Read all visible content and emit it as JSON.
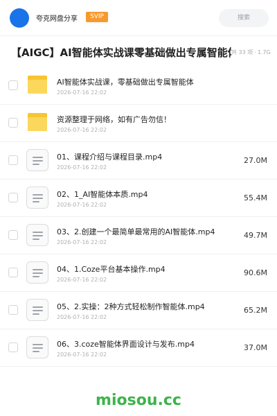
{
  "header": {
    "share_name": "夸克网盘分享",
    "badge": "SVIP",
    "search_placeholder": "搜索"
  },
  "folder": {
    "title": "【AIGC】AI智能体实战课零基础做出专属智能体",
    "item_count": "共 33 项",
    "total_size": "1.7G"
  },
  "items": [
    {
      "type": "folder",
      "name": "AI智能体实战课，零基础做出专属智能体",
      "date": "2026-07-16 22:02",
      "size": ""
    },
    {
      "type": "folder",
      "name": "资源整理于网络，如有广告勿信！",
      "date": "2026-07-16 22:02",
      "size": ""
    },
    {
      "type": "file",
      "name": "01、课程介绍与课程目录.mp4",
      "date": "2026-07-16 22:02",
      "size": "27.0M"
    },
    {
      "type": "file",
      "name": "02、1_AI智能体本质.mp4",
      "date": "2026-07-16 22:02",
      "size": "55.4M"
    },
    {
      "type": "file",
      "name": "03、2.创建一个最简单最常用的AI智能体.mp4",
      "date": "2026-07-16 22:02",
      "size": "49.7M"
    },
    {
      "type": "file",
      "name": "04、1.Coze平台基本操作.mp4",
      "date": "2026-07-16 22:02",
      "size": "90.6M"
    },
    {
      "type": "file",
      "name": "05、2.实操：2种方式轻松制作智能体.mp4",
      "date": "2026-07-16 22:02",
      "size": "65.2M"
    },
    {
      "type": "file",
      "name": "06、3.coze智能体界面设计与发布.mp4",
      "date": "2026-07-16 22:02",
      "size": "37.0M"
    }
  ],
  "watermark": "miosou.cc",
  "colors": {
    "accent": "#1a73e8",
    "svip": "#f79a2e",
    "folder": "#f7c531",
    "watermark": "#3cb44b"
  }
}
